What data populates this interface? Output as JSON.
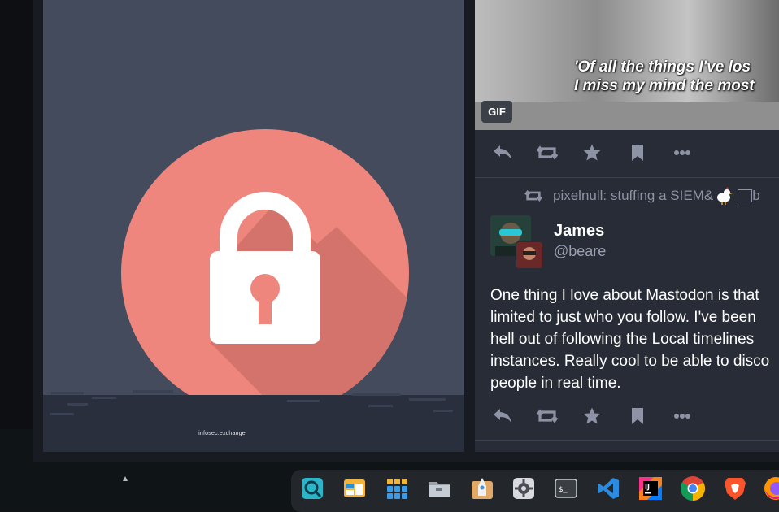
{
  "media_panel": {
    "instance_label": "infosec.exchange",
    "colors": {
      "background": "#444b5d",
      "circle": "#ef867d",
      "lock": "#ffffff",
      "shadow": "#d4736c"
    }
  },
  "gif_post": {
    "caption_line1": "'Of all the things I've los",
    "caption_line2": "I miss my mind the most",
    "badge": "GIF"
  },
  "action_icons": [
    "reply-icon",
    "boost-icon",
    "favourite-icon",
    "bookmark-icon",
    "more-icon"
  ],
  "boost_line": {
    "text": "pixelnull: stuffing a SIEM&",
    "trailing": " b"
  },
  "status": {
    "display_name": "James",
    "handle": "@beare",
    "lines": [
      "One thing I love about Mastodon is that",
      "limited to just who you follow. I've been",
      "hell out of following the Local timelines",
      "instances. Really cool to be able to disco",
      "people in real time."
    ]
  },
  "taskbar": {
    "apps": [
      "search-app-icon",
      "file-manager-icon",
      "app-grid-icon",
      "files-icon",
      "launcher-icon",
      "settings-icon",
      "terminal-icon",
      "vscode-icon",
      "intellij-icon",
      "chrome-icon",
      "brave-icon",
      "firefox-icon"
    ],
    "intellij_label": "IJ",
    "terminal_label": "$_"
  }
}
